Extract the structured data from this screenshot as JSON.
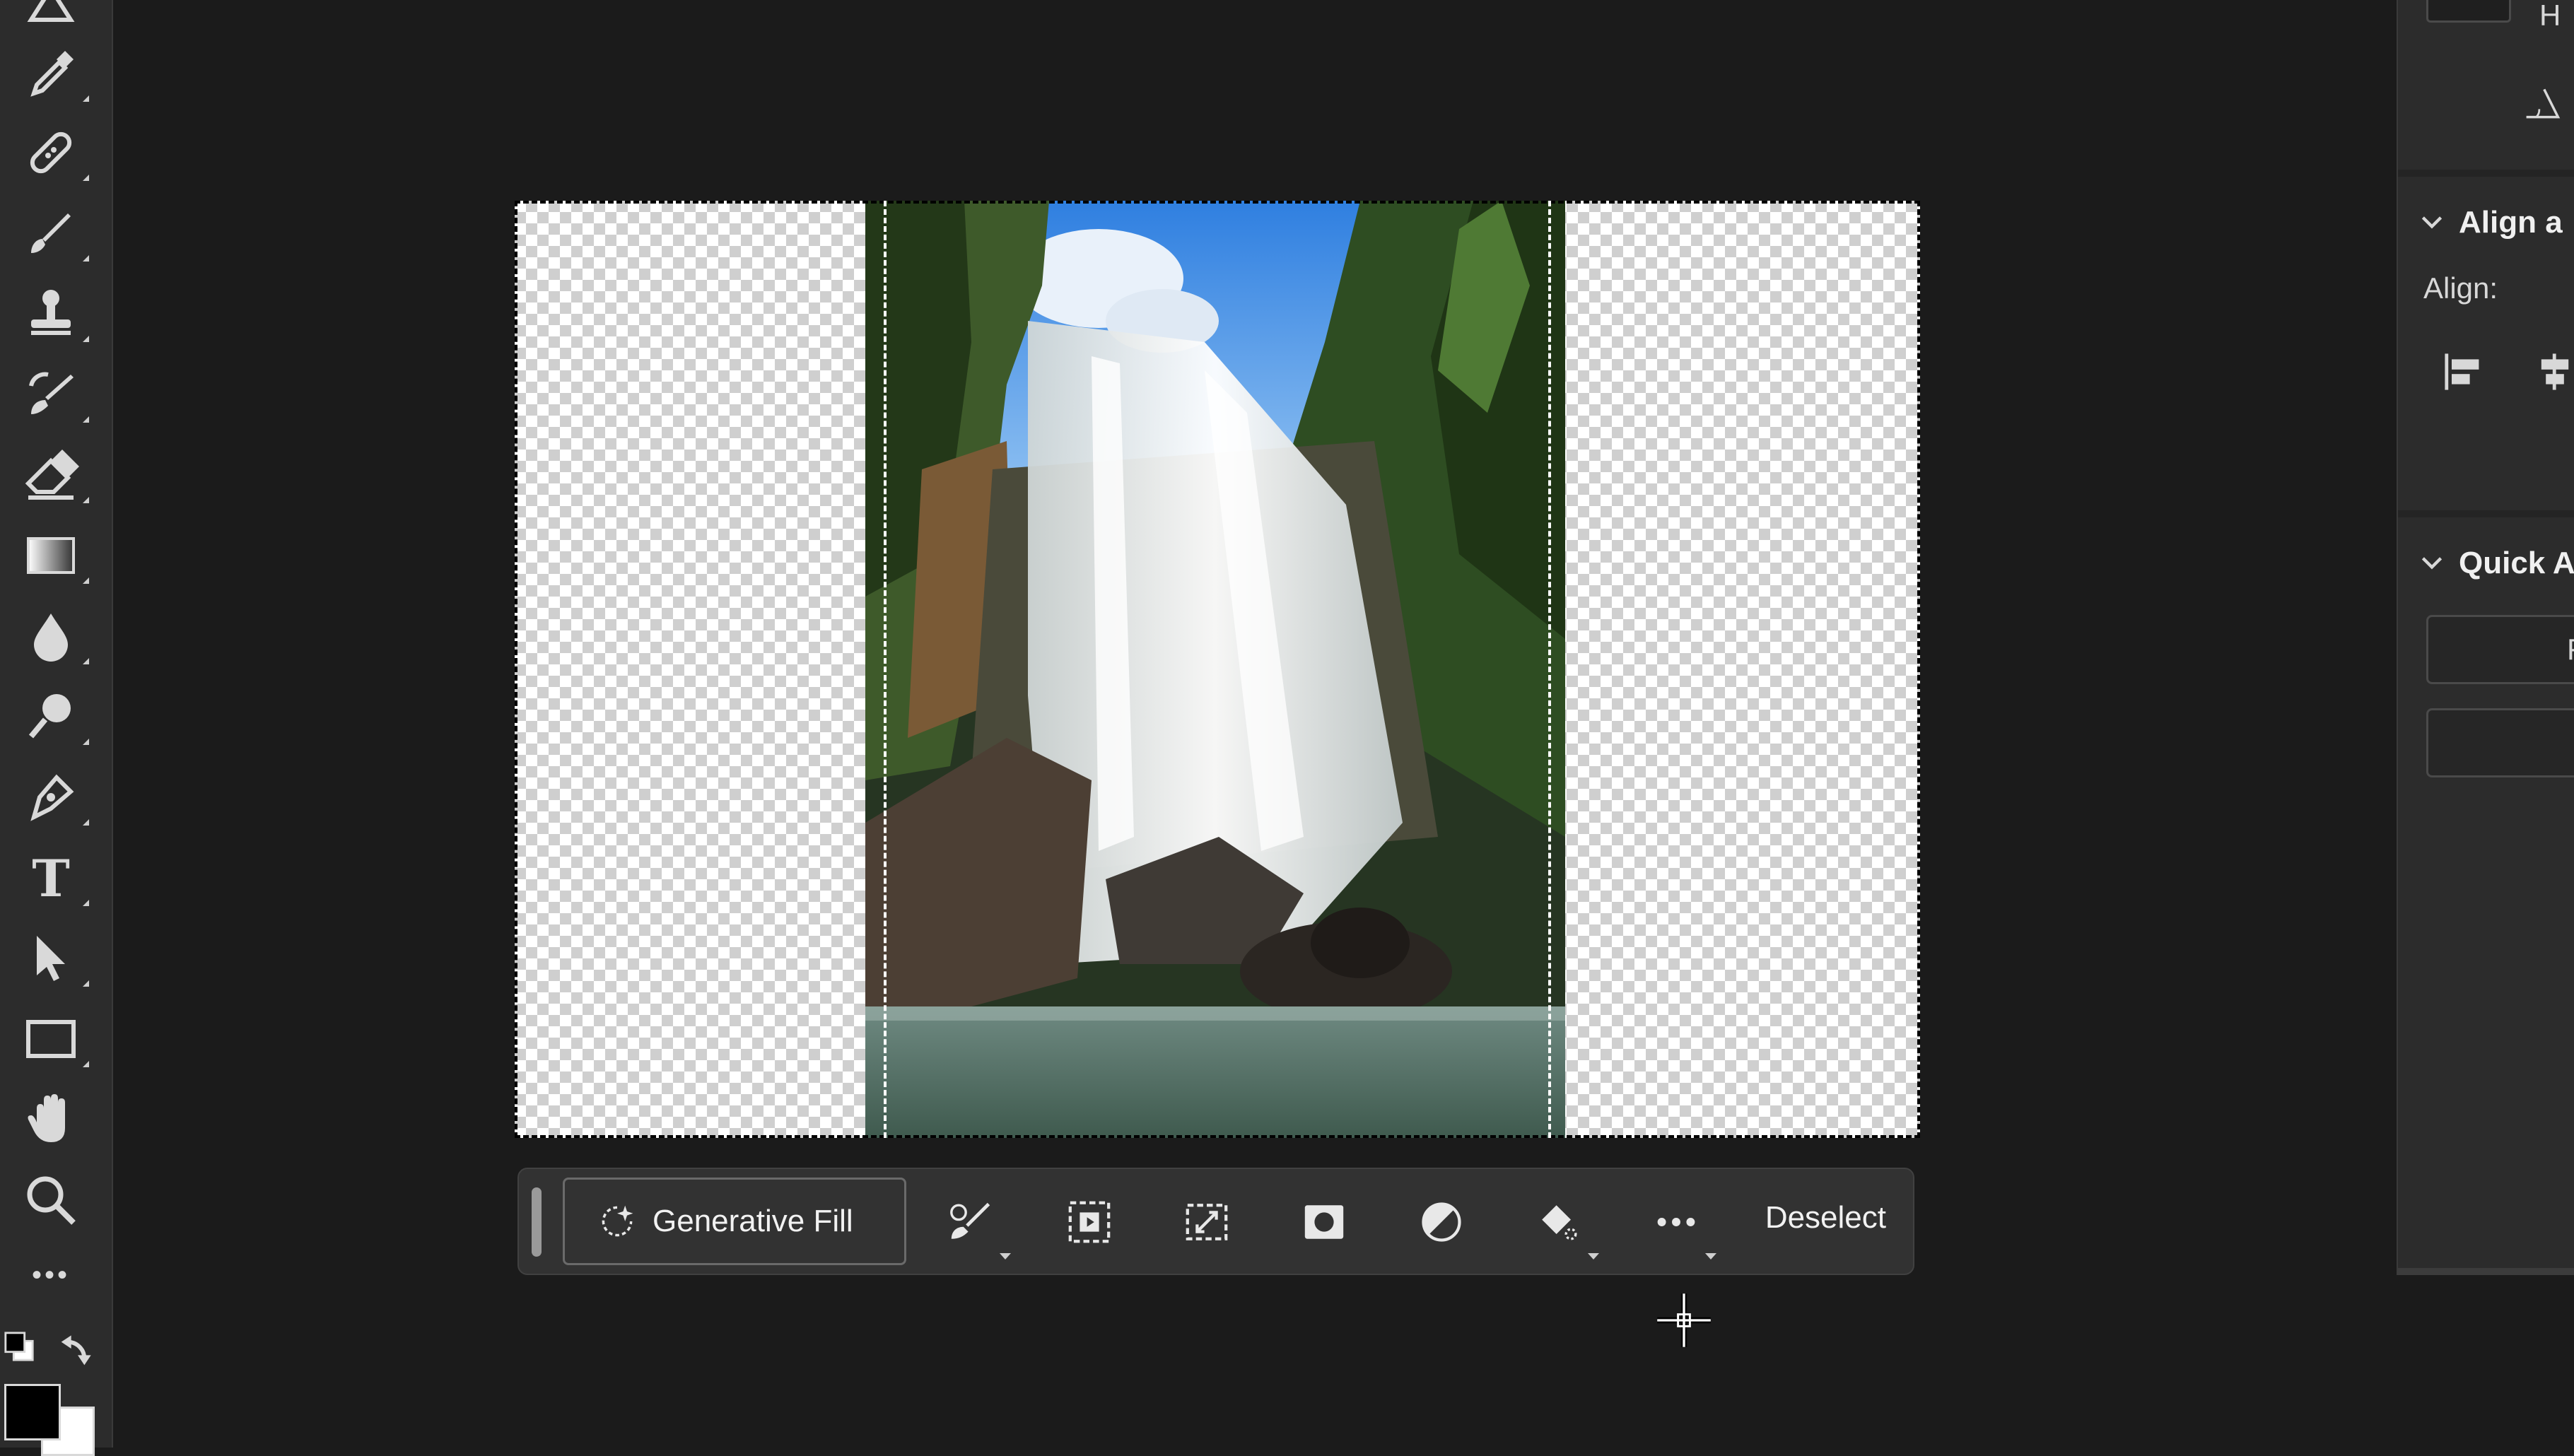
{
  "toolbar": {
    "tools": [
      "eyedropper-icon",
      "healing-brush-icon",
      "brush-icon",
      "clone-stamp-icon",
      "history-brush-icon",
      "eraser-icon",
      "gradient-icon",
      "blur-drop-icon",
      "dodge-icon",
      "pen-icon",
      "type-icon",
      "path-selection-icon",
      "rectangle-icon",
      "hand-icon",
      "zoom-icon",
      "more-tools-icon"
    ],
    "type_glyph": "T",
    "more_glyph": "•••",
    "foreground_color": "#000000",
    "background_color": "#ffffff"
  },
  "taskbar": {
    "generative_fill_label": "Generative Fill",
    "icons": [
      "brush-mask-icon",
      "select-subject-icon",
      "transform-selection-icon",
      "mask-icon",
      "invert-selection-icon",
      "fill-icon",
      "more-options-icon"
    ],
    "deselect_label": "Deselect"
  },
  "right_panel": {
    "top_letter": "H",
    "align_heading": "Align a",
    "align_label": "Align:",
    "quick_heading": "Quick A",
    "quick_button_letter": "F"
  },
  "colors": {
    "app_background": "#1b1b1b",
    "panel_background": "#2c2c2c",
    "taskbar_background": "#323232"
  }
}
